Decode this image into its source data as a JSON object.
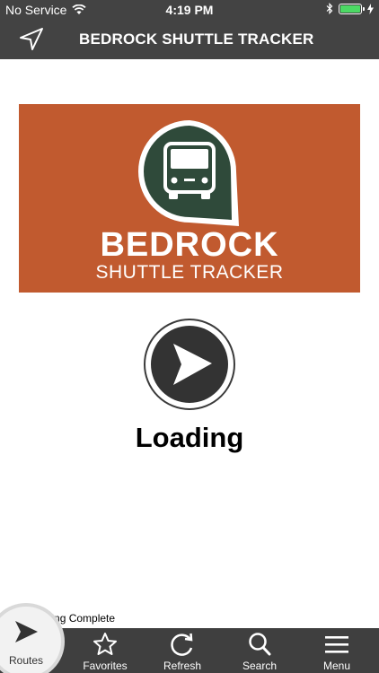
{
  "status_bar": {
    "carrier": "No Service",
    "time": "4:19 PM",
    "battery_level": 1.0
  },
  "nav": {
    "title": "BEDROCK SHUTTLE TRACKER",
    "location_icon": "location-arrow-icon"
  },
  "banner": {
    "brand_line1": "BEDROCK",
    "brand_line2": "SHUTTLE TRACKER",
    "logo_icon": "bus-pin-icon",
    "background_color": "#c15a2f",
    "pin_color": "#2f4a3a"
  },
  "main": {
    "loading_text": "Loading",
    "play_icon": "play-icon"
  },
  "status_message": "ading Complete",
  "tabs": [
    {
      "label": "Routes",
      "icon": "play-icon",
      "active": true
    },
    {
      "label": "Favorites",
      "icon": "star-icon"
    },
    {
      "label": "Refresh",
      "icon": "refresh-icon"
    },
    {
      "label": "Search",
      "icon": "search-icon"
    },
    {
      "label": "Menu",
      "icon": "hamburger-icon"
    }
  ]
}
